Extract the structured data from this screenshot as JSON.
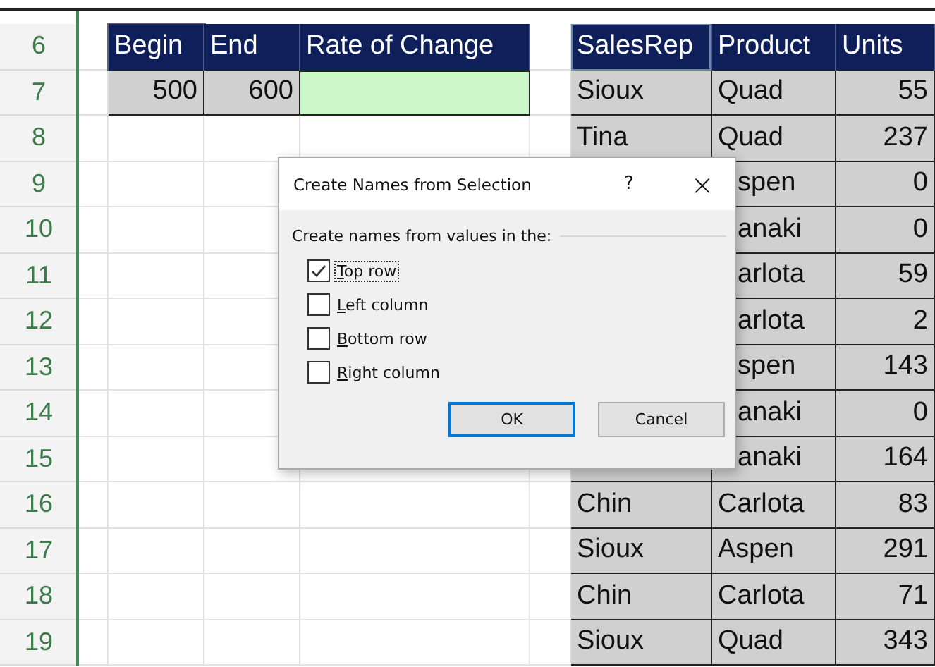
{
  "row_numbers": [
    "6",
    "7",
    "8",
    "9",
    "10",
    "11",
    "12",
    "13",
    "14",
    "15",
    "16",
    "17",
    "18",
    "19"
  ],
  "left_table": {
    "columns": [
      "Begin",
      "End",
      "Rate of Change"
    ],
    "values": [
      "500",
      "600"
    ]
  },
  "right_table": {
    "columns": [
      "SalesRep",
      "Product",
      "Units"
    ],
    "rows": [
      {
        "sales_rep": "Sioux",
        "product": "Quad",
        "covered": false,
        "units": "55"
      },
      {
        "sales_rep": "Tina",
        "product": "Quad",
        "covered": false,
        "units": "237"
      },
      {
        "product": "spen",
        "covered": true,
        "units": "0"
      },
      {
        "product": "anaki",
        "covered": true,
        "units": "0"
      },
      {
        "product": "arlota",
        "covered": true,
        "units": "59"
      },
      {
        "product": "arlota",
        "covered": true,
        "units": "2"
      },
      {
        "product": "spen",
        "covered": true,
        "units": "143"
      },
      {
        "product": "anaki",
        "covered": true,
        "units": "0"
      },
      {
        "product": "anaki",
        "covered": true,
        "units": "164"
      },
      {
        "sales_rep": "Chin",
        "product": "Carlota",
        "covered": false,
        "units": "83"
      },
      {
        "sales_rep": "Sioux",
        "product": "Aspen",
        "covered": false,
        "units": "291"
      },
      {
        "sales_rep": "Chin",
        "product": "Carlota",
        "covered": false,
        "units": "71"
      },
      {
        "sales_rep": "Sioux",
        "product": "Quad",
        "covered": false,
        "units": "343"
      }
    ]
  },
  "dialog": {
    "title": "Create Names from Selection",
    "help": "?",
    "close": "×",
    "group_label": "Create names from values in the:",
    "options": [
      {
        "key": "T",
        "rest": "op row",
        "checked": true,
        "focused": true
      },
      {
        "key": "L",
        "rest": "eft column",
        "checked": false,
        "focused": false
      },
      {
        "key": "B",
        "rest": "ottom row",
        "checked": false,
        "focused": false
      },
      {
        "key": "R",
        "rest": "ight column",
        "checked": false,
        "focused": false
      }
    ],
    "buttons": [
      {
        "label": "OK",
        "default": true
      },
      {
        "label": "Cancel",
        "default": false
      }
    ]
  }
}
